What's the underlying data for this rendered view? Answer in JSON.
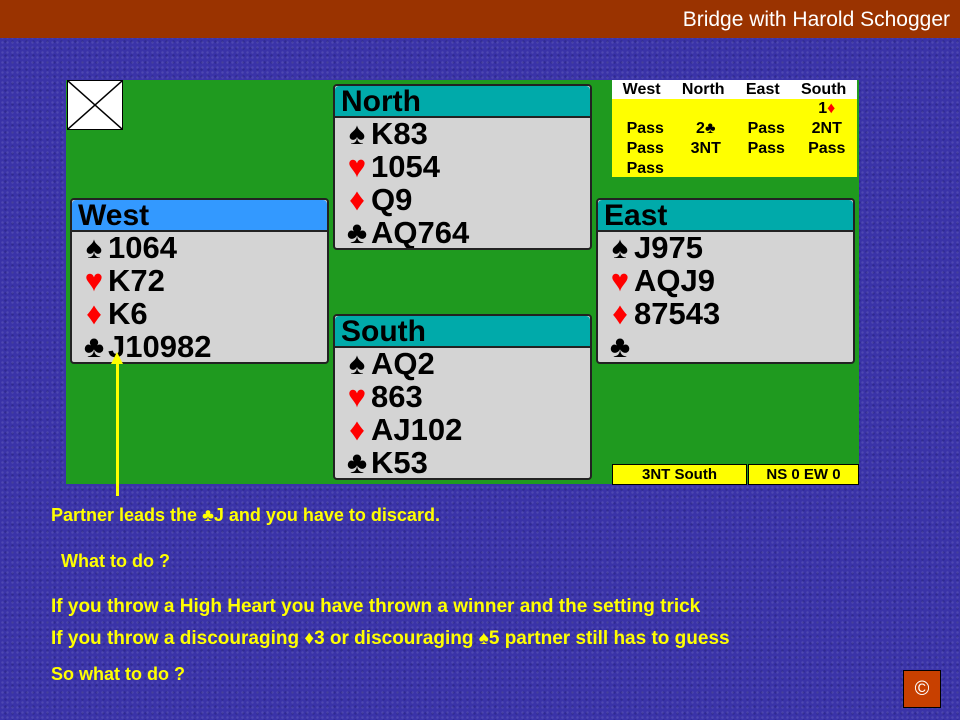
{
  "header": {
    "title": "Bridge with Harold Schogger"
  },
  "hands": {
    "north": {
      "name": "North",
      "spades": "K83",
      "hearts": "1054",
      "diamonds": "Q9",
      "clubs": "AQ764"
    },
    "west": {
      "name": "West",
      "spades": "1064",
      "hearts": "K72",
      "diamonds": "K6",
      "clubs": "J10982"
    },
    "east": {
      "name": "East",
      "spades": "J975",
      "hearts": "AQJ9",
      "diamonds": "87543",
      "clubs": ""
    },
    "south": {
      "name": "South",
      "spades": "AQ2",
      "hearts": "863",
      "diamonds": "AJ102",
      "clubs": "K53"
    }
  },
  "suit_symbols": {
    "spades": "♠",
    "hearts": "♥",
    "diamonds": "♦",
    "clubs": "♣"
  },
  "colors": {
    "red_suit": "#ff0000",
    "text_yellow": "#ffff00",
    "felt": "#1f9a1f",
    "header_bar": "#9a3300"
  },
  "auction": {
    "headers": [
      "West",
      "North",
      "East",
      "South"
    ],
    "rows": [
      [
        "",
        "",
        "",
        "1♦"
      ],
      [
        "Pass",
        "2♣",
        "Pass",
        "2NT"
      ],
      [
        "Pass",
        "3NT",
        "Pass",
        "Pass"
      ],
      [
        "Pass",
        "",
        "",
        ""
      ]
    ]
  },
  "contract": "3NT South",
  "score": "NS 0 EW 0",
  "text": {
    "line1": {
      "before": "Partner leads the ",
      "suit": "♣",
      "after": "J and you have to discard."
    },
    "line2": "What to do ?",
    "line3": "If you throw a High Heart you have thrown a winner and the setting trick",
    "line4": {
      "p1": "If you throw a discouraging ",
      "s1": "♦",
      "p2": "3 or discouraging ",
      "s2": "♠",
      "p3": "5  partner still has to guess"
    },
    "line5": "So what to do ?"
  },
  "copyright_symbol": "©"
}
